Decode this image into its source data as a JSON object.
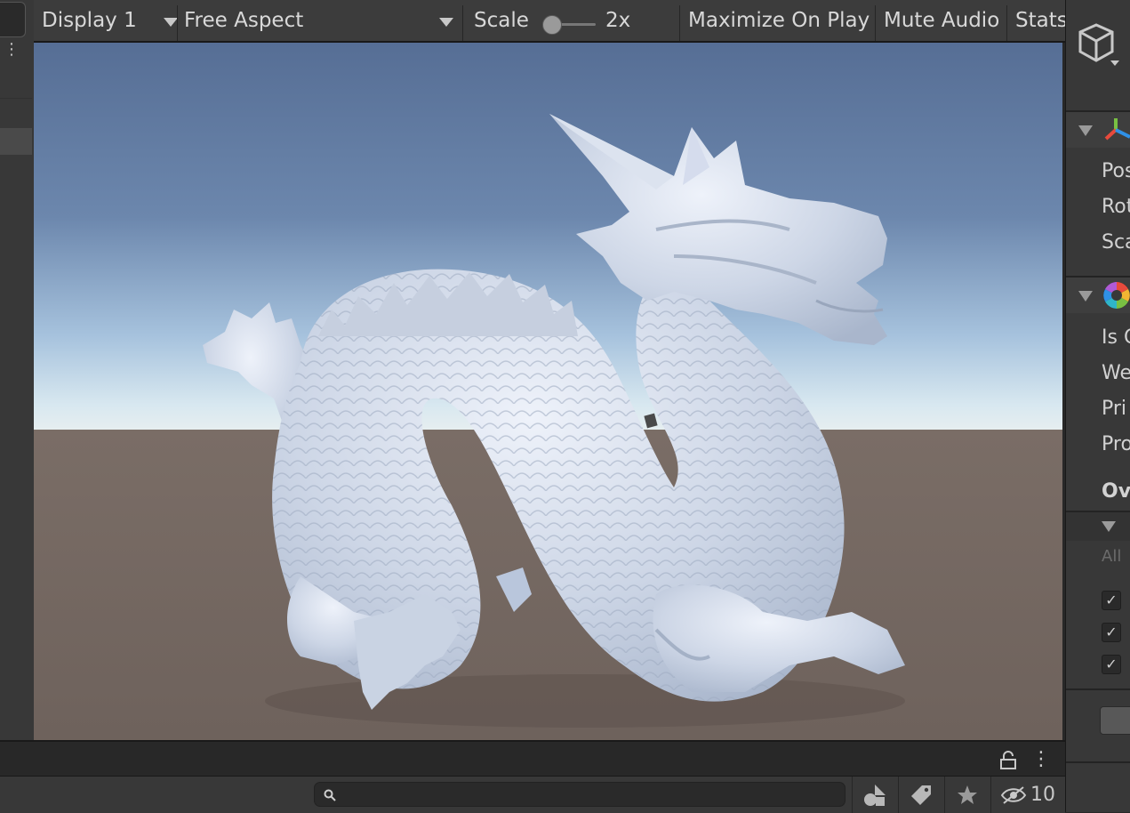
{
  "toolbar": {
    "display": "Display 1",
    "aspect": "Free Aspect",
    "scale_label": "Scale",
    "scale_value": "2x",
    "maximize": "Maximize On Play",
    "mute": "Mute Audio",
    "stats": "Stats"
  },
  "inspector": {
    "transform_rows": [
      "Pos",
      "Rot",
      "Sca"
    ],
    "volume_rows": [
      "Is G",
      "We",
      "Pri",
      "Pro"
    ],
    "overrides_label": "Ove",
    "all_label": "All",
    "checkbox_mark": "✓"
  },
  "bottom": {
    "hidden_count": "10",
    "search_placeholder": ""
  },
  "colors": {
    "accent_red": "#e84a3c",
    "accent_green": "#79c043",
    "accent_blue": "#2f90e6"
  },
  "icons": [
    "cube-icon",
    "transform-icon",
    "volume-icon",
    "lock-icon",
    "kebab-icon",
    "search-icon",
    "shapes-icon",
    "tag-icon",
    "star-icon",
    "eye-hidden-icon"
  ]
}
